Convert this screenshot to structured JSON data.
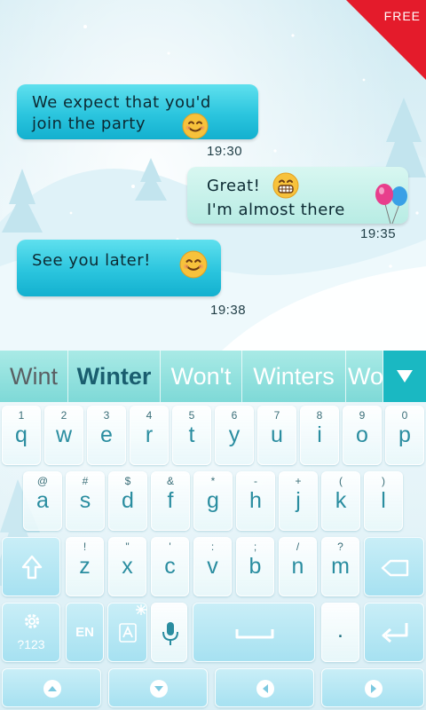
{
  "badge": {
    "free_label": "FREE"
  },
  "chat": {
    "messages": [
      {
        "line1": "We expect that you'd",
        "line2": "join the party",
        "time": "19:30",
        "emoji": "smiling-face-icon"
      },
      {
        "line1": "Great!",
        "line2": "I'm almost there",
        "time": "19:35",
        "emoji": "grinning-face-icon",
        "decoration": "balloons-icon"
      },
      {
        "line1": "See you later!",
        "time": "19:38",
        "emoji": "smiling-face-icon"
      }
    ]
  },
  "suggestions": {
    "typed": "Wint",
    "primary": "Winter",
    "items": [
      "Won't",
      "Winters",
      "Wo"
    ],
    "collapse_icon": "triangle-down-icon"
  },
  "keyboard": {
    "row1": [
      {
        "hint": "1",
        "key": "q"
      },
      {
        "hint": "2",
        "key": "w"
      },
      {
        "hint": "3",
        "key": "e"
      },
      {
        "hint": "4",
        "key": "r"
      },
      {
        "hint": "5",
        "key": "t"
      },
      {
        "hint": "6",
        "key": "y"
      },
      {
        "hint": "7",
        "key": "u"
      },
      {
        "hint": "8",
        "key": "i"
      },
      {
        "hint": "9",
        "key": "o"
      },
      {
        "hint": "0",
        "key": "p"
      }
    ],
    "row2": [
      {
        "hint": "@",
        "key": "a"
      },
      {
        "hint": "#",
        "key": "s"
      },
      {
        "hint": "$",
        "key": "d"
      },
      {
        "hint": "&",
        "key": "f"
      },
      {
        "hint": "*",
        "key": "g"
      },
      {
        "hint": "-",
        "key": "h"
      },
      {
        "hint": "+",
        "key": "j"
      },
      {
        "hint": "(",
        "key": "k"
      },
      {
        "hint": ")",
        "key": "l"
      }
    ],
    "row3": [
      {
        "hint": "!",
        "key": "z"
      },
      {
        "hint": "\"",
        "key": "x"
      },
      {
        "hint": "'",
        "key": "c"
      },
      {
        "hint": ":",
        "key": "v"
      },
      {
        "hint": ";",
        "key": "b"
      },
      {
        "hint": "/",
        "key": "n"
      },
      {
        "hint": "?",
        "key": "m"
      }
    ],
    "shift_icon": "shift-arrow-icon",
    "backspace_icon": "backspace-icon",
    "settings_label": "?123",
    "settings_icon": "gear-icon",
    "language_label": "EN",
    "settings_corner_icon": "snowflake-icon",
    "input_mode_icon": "text-input-icon",
    "mic_icon": "microphone-icon",
    "space_icon": "space-bar-icon",
    "period_label": ".",
    "enter_icon": "enter-icon",
    "nav": [
      "arrow-up-icon",
      "arrow-down-icon",
      "arrow-left-icon",
      "arrow-right-icon"
    ]
  },
  "colors": {
    "incoming_bubble": "#2bc5de",
    "outgoing_bubble": "#c3efe8",
    "suggestion_bar": "#8fe0dd",
    "key_text": "#2a8da0",
    "ribbon": "#e41b2b"
  }
}
